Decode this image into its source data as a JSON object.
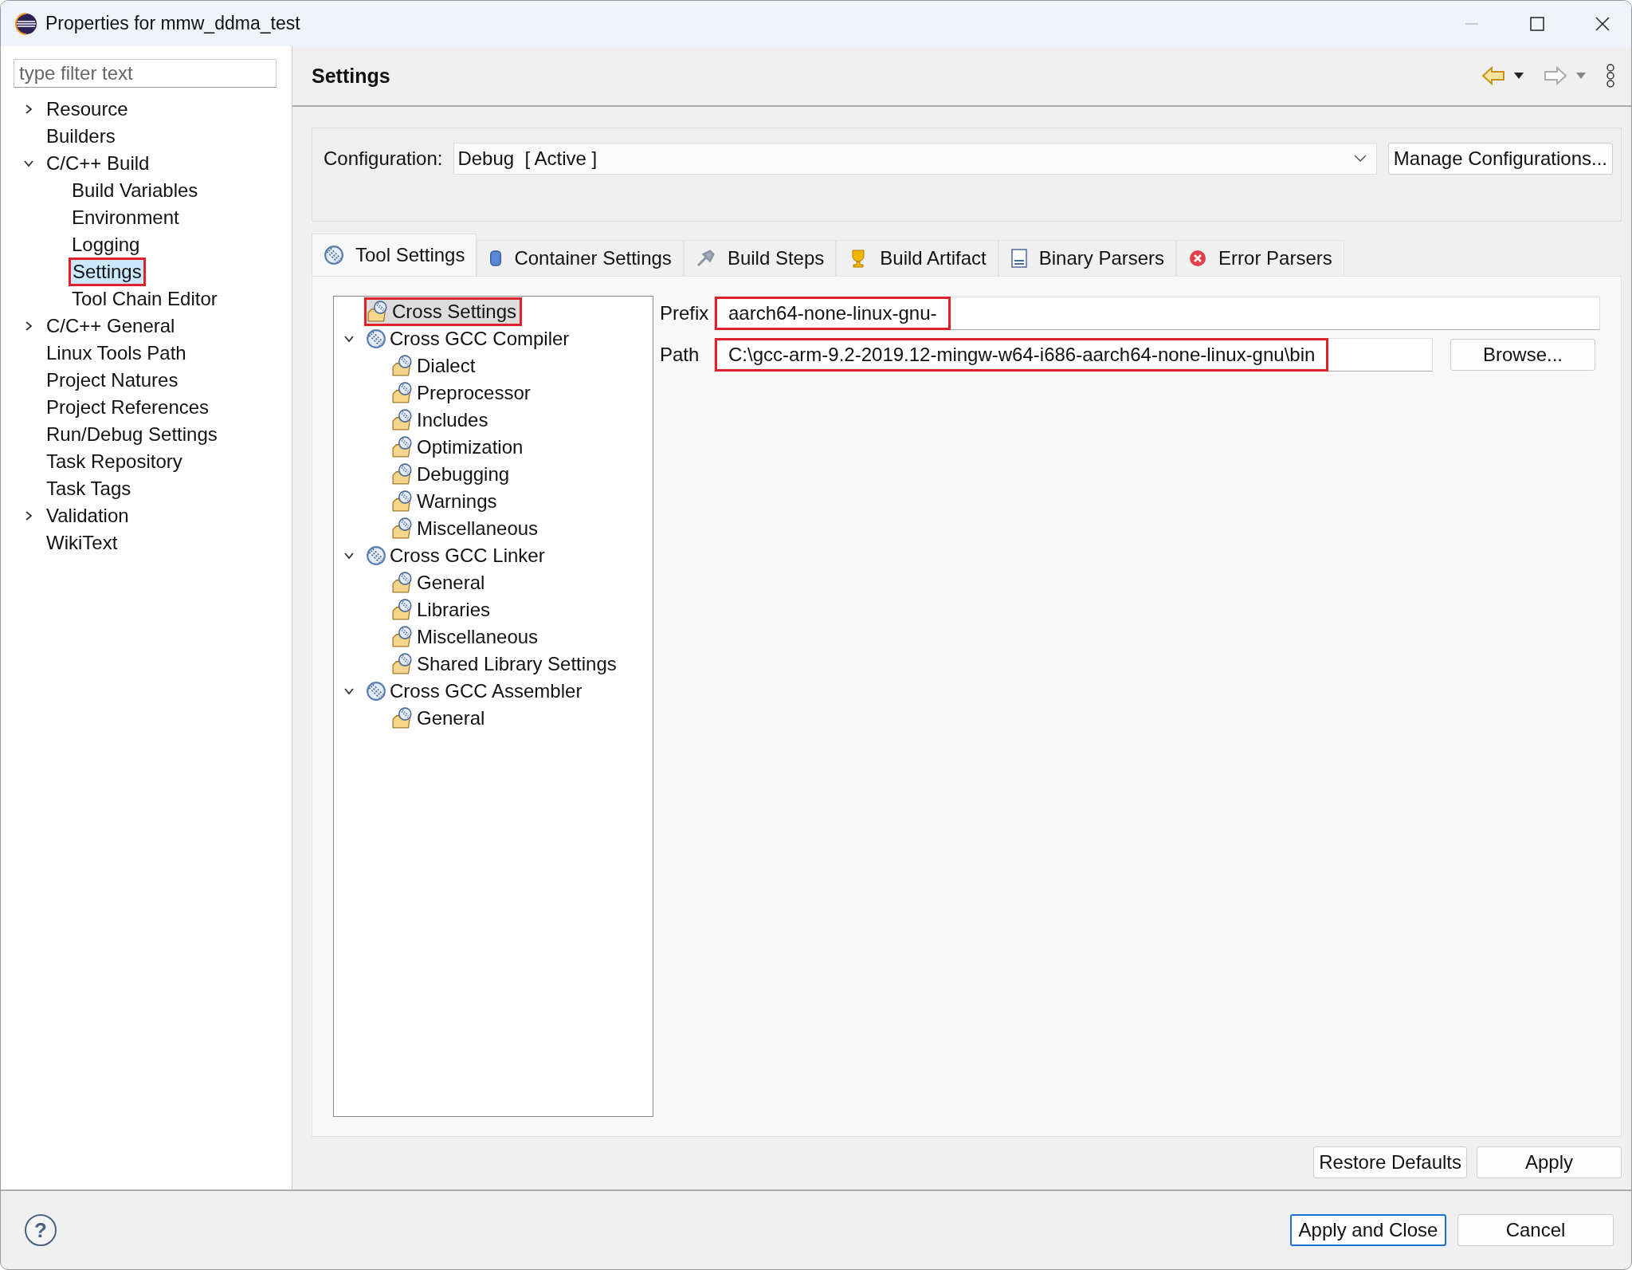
{
  "window": {
    "title": "Properties for mmw_ddma_test"
  },
  "sidebar": {
    "filter": {
      "placeholder": "type filter text"
    },
    "items": [
      {
        "label": "Resource",
        "expanded": false,
        "selected": false,
        "highlighted": false
      },
      {
        "label": "Builders",
        "selected": false,
        "highlighted": false
      },
      {
        "label": "C/C++ Build",
        "expanded": true,
        "selected": false,
        "highlighted": false,
        "children": [
          {
            "label": "Build Variables",
            "selected": false,
            "highlighted": false
          },
          {
            "label": "Environment",
            "selected": false,
            "highlighted": false
          },
          {
            "label": "Logging",
            "selected": false,
            "highlighted": false
          },
          {
            "label": "Settings",
            "selected": true,
            "highlighted": true
          },
          {
            "label": "Tool Chain Editor",
            "selected": false,
            "highlighted": false
          }
        ]
      },
      {
        "label": "C/C++ General",
        "expanded": false,
        "selected": false,
        "highlighted": false
      },
      {
        "label": "Linux Tools Path",
        "selected": false,
        "highlighted": false
      },
      {
        "label": "Project Natures",
        "selected": false,
        "highlighted": false
      },
      {
        "label": "Project References",
        "selected": false,
        "highlighted": false
      },
      {
        "label": "Run/Debug Settings",
        "selected": false,
        "highlighted": false
      },
      {
        "label": "Task Repository",
        "selected": false,
        "highlighted": false
      },
      {
        "label": "Task Tags",
        "selected": false,
        "highlighted": false
      },
      {
        "label": "Validation",
        "expanded": false,
        "selected": false,
        "highlighted": false
      },
      {
        "label": "WikiText",
        "selected": false,
        "highlighted": false
      }
    ]
  },
  "page": {
    "title": "Settings",
    "configuration": {
      "label": "Configuration:",
      "value": "Debug  [ Active ]",
      "button": "Manage Configurations..."
    },
    "tabs": [
      {
        "label": "Tool Settings",
        "kind": "tool",
        "selected": true
      },
      {
        "label": "Container Settings",
        "kind": "container",
        "selected": false
      },
      {
        "label": "Build Steps",
        "kind": "steps",
        "selected": false
      },
      {
        "label": "Build Artifact",
        "kind": "artifact",
        "selected": false
      },
      {
        "label": "Binary Parsers",
        "kind": "binary",
        "selected": false
      },
      {
        "label": "Error Parsers",
        "kind": "error",
        "selected": false
      }
    ],
    "tool_tree": [
      {
        "label": "Cross Settings",
        "kind": "option",
        "selected": true,
        "highlighted": true
      },
      {
        "label": "Cross GCC Compiler",
        "kind": "tool",
        "expanded": true,
        "selected": false,
        "highlighted": false,
        "children": [
          {
            "label": "Dialect",
            "kind": "option",
            "selected": false,
            "highlighted": false
          },
          {
            "label": "Preprocessor",
            "kind": "option",
            "selected": false,
            "highlighted": false
          },
          {
            "label": "Includes",
            "kind": "option",
            "selected": false,
            "highlighted": false
          },
          {
            "label": "Optimization",
            "kind": "option",
            "selected": false,
            "highlighted": false
          },
          {
            "label": "Debugging",
            "kind": "option",
            "selected": false,
            "highlighted": false
          },
          {
            "label": "Warnings",
            "kind": "option",
            "selected": false,
            "highlighted": false
          },
          {
            "label": "Miscellaneous",
            "kind": "option",
            "selected": false,
            "highlighted": false
          }
        ]
      },
      {
        "label": "Cross GCC Linker",
        "kind": "tool",
        "expanded": true,
        "selected": false,
        "highlighted": false,
        "children": [
          {
            "label": "General",
            "kind": "option",
            "selected": false,
            "highlighted": false
          },
          {
            "label": "Libraries",
            "kind": "option",
            "selected": false,
            "highlighted": false
          },
          {
            "label": "Miscellaneous",
            "kind": "option",
            "selected": false,
            "highlighted": false
          },
          {
            "label": "Shared Library Settings",
            "kind": "option",
            "selected": false,
            "highlighted": false
          }
        ]
      },
      {
        "label": "Cross GCC Assembler",
        "kind": "tool",
        "expanded": true,
        "selected": false,
        "highlighted": false,
        "children": [
          {
            "label": "General",
            "kind": "option",
            "selected": false,
            "highlighted": false
          }
        ]
      }
    ],
    "prefix": {
      "label": "Prefix",
      "value": "aarch64-none-linux-gnu-",
      "highlighted": true
    },
    "path": {
      "label": "Path",
      "value": "C:\\gcc-arm-9.2-2019.12-mingw-w64-i686-aarch64-none-linux-gnu\\bin",
      "highlighted": true,
      "button": "Browse..."
    },
    "buttons": [
      "Restore Defaults",
      "Apply"
    ]
  },
  "footer": {
    "help": "?",
    "buttons": [
      {
        "label": "Apply and Close",
        "selected": true
      },
      {
        "label": "Cancel",
        "selected": false
      }
    ]
  }
}
